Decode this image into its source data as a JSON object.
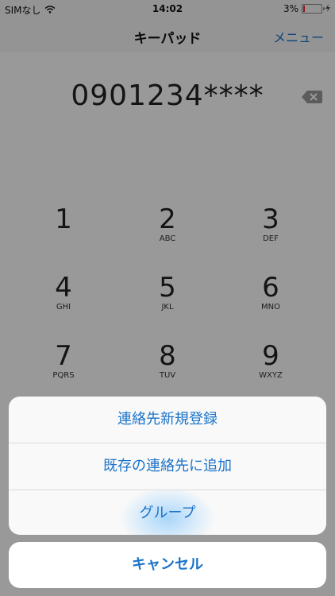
{
  "status": {
    "carrier": "SIMなし",
    "time": "14:02",
    "battery": "3%"
  },
  "nav": {
    "title": "キーパッド",
    "menu": "メニュー"
  },
  "display": {
    "number": "0901234****"
  },
  "keys": [
    {
      "digit": "1",
      "letters": ""
    },
    {
      "digit": "2",
      "letters": "ABC"
    },
    {
      "digit": "3",
      "letters": "DEF"
    },
    {
      "digit": "4",
      "letters": "GHI"
    },
    {
      "digit": "5",
      "letters": "JKL"
    },
    {
      "digit": "6",
      "letters": "MNO"
    },
    {
      "digit": "7",
      "letters": "PQRS"
    },
    {
      "digit": "8",
      "letters": "TUV"
    },
    {
      "digit": "9",
      "letters": "WXYZ"
    }
  ],
  "sheet": {
    "options": [
      "連絡先新規登録",
      "既存の連絡先に追加",
      "グループ"
    ],
    "cancel": "キャンセル"
  },
  "colors": {
    "accent": "#1a73c9",
    "battery_low": "#e23"
  }
}
